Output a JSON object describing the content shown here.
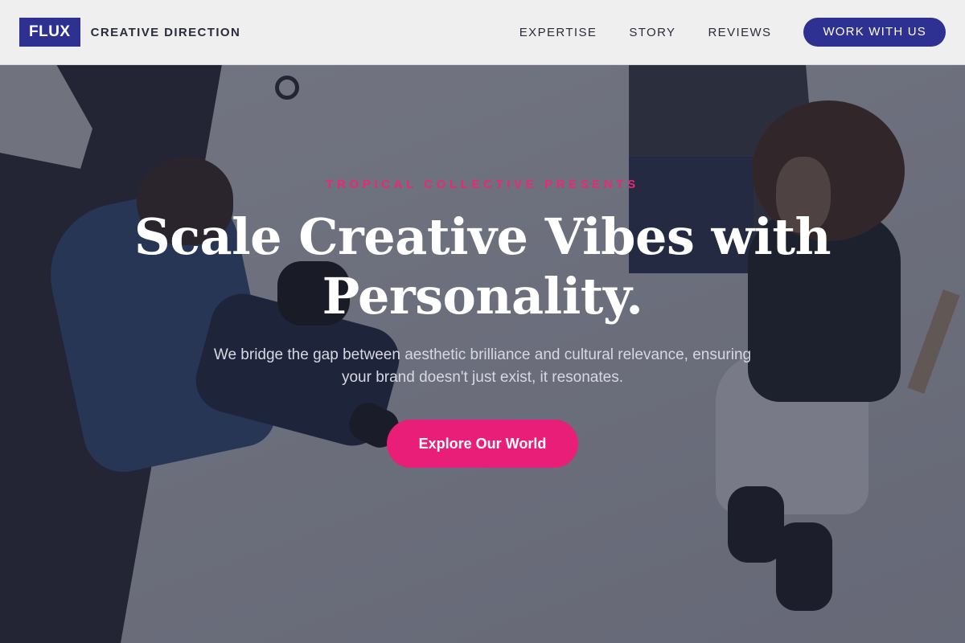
{
  "nav": {
    "logo": "FLUX",
    "tagline": "CREATIVE DIRECTION",
    "links": [
      "EXPERTISE",
      "STORY",
      "REVIEWS"
    ],
    "cta": "WORK WITH US"
  },
  "hero": {
    "eyebrow": "TROPICAL COLLECTIVE PRESENTS",
    "headline": "Scale Creative Vibes with Personality.",
    "subtext": "We bridge the gap between aesthetic brilliance and cultural relevance, ensuring your brand doesn't just exist, it resonates.",
    "button": "Explore Our World"
  },
  "colors": {
    "brand": "#2e3192",
    "accent": "#e91e78",
    "overlay": "#1e2034"
  }
}
